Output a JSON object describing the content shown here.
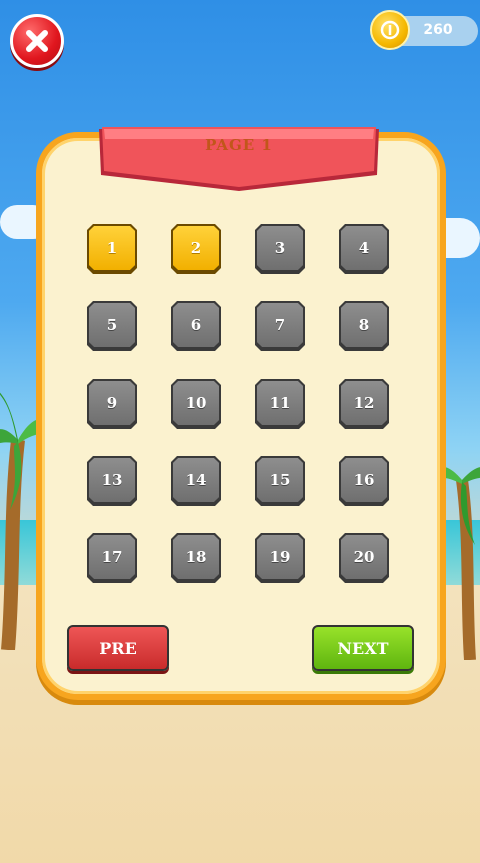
{
  "hud": {
    "close_icon": "close-x-icon",
    "coin_icon": "coin-icon",
    "coins": "260"
  },
  "panel": {
    "title": "PAGE 1",
    "levels": [
      {
        "label": "1",
        "state": "unlocked"
      },
      {
        "label": "2",
        "state": "unlocked"
      },
      {
        "label": "3",
        "state": "locked"
      },
      {
        "label": "4",
        "state": "locked"
      },
      {
        "label": "5",
        "state": "locked"
      },
      {
        "label": "6",
        "state": "locked"
      },
      {
        "label": "7",
        "state": "locked"
      },
      {
        "label": "8",
        "state": "locked"
      },
      {
        "label": "9",
        "state": "locked"
      },
      {
        "label": "10",
        "state": "locked"
      },
      {
        "label": "11",
        "state": "locked"
      },
      {
        "label": "12",
        "state": "locked"
      },
      {
        "label": "13",
        "state": "locked"
      },
      {
        "label": "14",
        "state": "locked"
      },
      {
        "label": "15",
        "state": "locked"
      },
      {
        "label": "16",
        "state": "locked"
      },
      {
        "label": "17",
        "state": "locked"
      },
      {
        "label": "18",
        "state": "locked"
      },
      {
        "label": "19",
        "state": "locked"
      },
      {
        "label": "20",
        "state": "locked"
      }
    ],
    "pre_label": "PRE",
    "next_label": "NEXT"
  },
  "colors": {
    "unlocked": "#f2b000",
    "locked": "#7a7a7a",
    "pre": "#d93636",
    "next": "#76c81a",
    "panel_border": "#f7a51e",
    "ribbon": "#f0545a"
  }
}
